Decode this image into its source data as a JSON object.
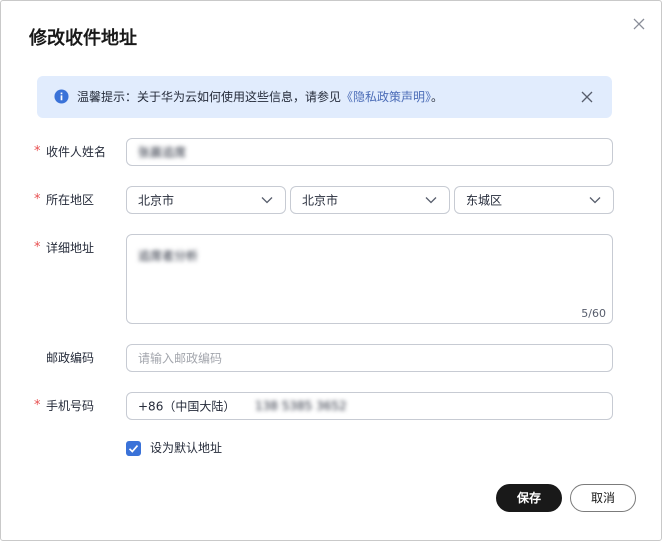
{
  "dialog": {
    "title": "修改收件地址",
    "close_icon": "close-icon"
  },
  "notice": {
    "icon": "info-icon",
    "prefix": "温馨提示：关于华为云如何使用这些信息，请参见",
    "link": "《隐私政策声明》",
    "suffix": "。",
    "close_icon": "close-icon"
  },
  "form": {
    "required_mark": "*",
    "name": {
      "label": "收件人姓名",
      "value": "张晨追席"
    },
    "region": {
      "label": "所在地区",
      "province": "北京市",
      "city": "北京市",
      "district": "东城区"
    },
    "address": {
      "label": "详细地址",
      "value": "追席者分析",
      "counter": "5/60"
    },
    "postcode": {
      "label": "邮政编码",
      "placeholder": "请输入邮政编码"
    },
    "phone": {
      "label": "手机号码",
      "country_code": "+86（中国大陆）",
      "value": "138 5385 3652"
    },
    "default_checkbox": {
      "label": "设为默认地址",
      "checked": true
    }
  },
  "buttons": {
    "save": "保存",
    "cancel": "取消"
  },
  "colors": {
    "accent": "#3a72d8",
    "required": "#e84e4f",
    "notice_bg": "#e1ecfd",
    "primary_button": "#191919"
  }
}
